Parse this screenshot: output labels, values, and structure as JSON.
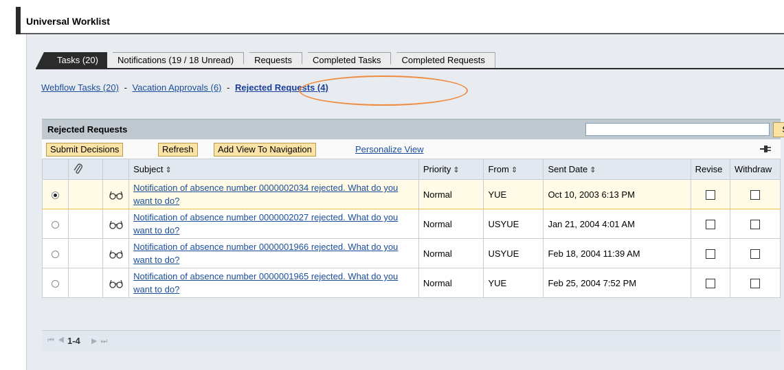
{
  "page": {
    "title": "Universal Worklist"
  },
  "tabs": [
    {
      "label": "Tasks (20)"
    },
    {
      "label": "Notifications (19 / 18 Unread)"
    },
    {
      "label": "Requests"
    },
    {
      "label": "Completed Tasks"
    },
    {
      "label": "Completed Requests"
    }
  ],
  "subnav": {
    "items": [
      {
        "label": "Webflow Tasks (20)"
      },
      {
        "label": "Vacation Approvals (6)"
      },
      {
        "label": "Rejected Requests (4)"
      }
    ],
    "separator": "-"
  },
  "table": {
    "title": "Rejected Requests",
    "search_label": "Search",
    "search_value": "",
    "toolbar": {
      "submit": "Submit Decisions",
      "refresh": "Refresh",
      "add_view": "Add View To Navigation",
      "personalize": "Personalize View"
    },
    "columns": {
      "subject": "Subject",
      "priority": "Priority",
      "from": "From",
      "sent_date": "Sent Date",
      "revise": "Revise",
      "withdraw": "Withdraw"
    },
    "rows": [
      {
        "subject": "Notification of absence number 0000002034 rejected. What do you want to do?",
        "priority": "Normal",
        "from": "YUE",
        "sent_date": "Oct 10, 2003 6:13 PM",
        "selected": true
      },
      {
        "subject": "Notification of absence number 0000002027 rejected. What do you want to do?",
        "priority": "Normal",
        "from": "USYUE",
        "sent_date": "Jan 21, 2004 4:01 AM",
        "selected": false
      },
      {
        "subject": "Notification of absence number 0000001966 rejected. What do you want to do?",
        "priority": "Normal",
        "from": "USYUE",
        "sent_date": "Feb 18, 2004 11:39 AM",
        "selected": false
      },
      {
        "subject": "Notification of absence number 0000001965 rejected. What do you want to do?",
        "priority": "Normal",
        "from": "YUE",
        "sent_date": "Feb 25, 2004 7:52 PM",
        "selected": false
      }
    ],
    "pager": {
      "range": "1-4"
    }
  },
  "colors": {
    "link": "#1a4e9a",
    "button_bg": "#fbe3a5",
    "highlight": "#f08a3c",
    "active_tab": "#2b2b2b"
  }
}
